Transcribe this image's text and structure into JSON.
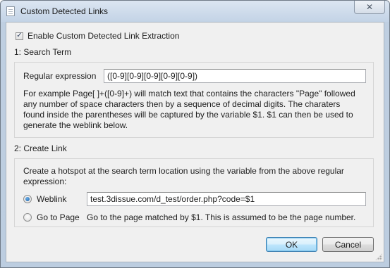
{
  "window": {
    "title": "Custom Detected Links",
    "close_glyph": "✕",
    "icon": "document-icon"
  },
  "enable_checkbox": {
    "label": "Enable Custom Detected Link Extraction",
    "checked": true,
    "glyph": "✓"
  },
  "search_term": {
    "section_title": "1: Search Term",
    "regex_label": "Regular expression",
    "regex_value": "([0-9][0-9][0-9][0-9][0-9])",
    "description_lines": [
      "For example Page[ ]+([0-9]+) will match text that contains the characters \"Page\" followed",
      "any number of space characters then by a sequence of  decimal digits. The charaters",
      "found inside the parentheses will be captured by the variable $1. $1 can then be used to",
      "generate the weblink below."
    ]
  },
  "create_link": {
    "section_title": "2: Create Link",
    "description_lines": [
      "Create a hotspot at the search term location using the variable from the above regular",
      "expression:"
    ],
    "weblink": {
      "label": "Weblink",
      "selected": true,
      "value": "test.3dissue.com/d_test/order.php?code=$1"
    },
    "goto_page": {
      "label": "Go to Page",
      "selected": false,
      "description": "Go to the  page matched by $1. This  is assumed to be the page number."
    }
  },
  "buttons": {
    "ok_label": "OK",
    "cancel_label": "Cancel"
  },
  "colors": {
    "frame": "#bccde0",
    "client": "#f0f0f0",
    "default_button_border": "#3c7fb1",
    "radio_dot": "#1c5fa8"
  }
}
